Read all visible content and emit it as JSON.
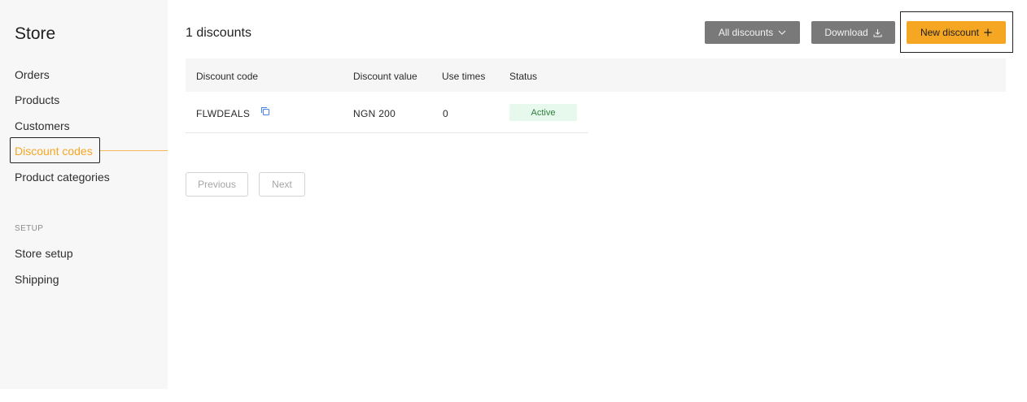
{
  "sidebar": {
    "title": "Store",
    "items": [
      {
        "label": "Orders"
      },
      {
        "label": "Products"
      },
      {
        "label": "Customers"
      },
      {
        "label": "Discount codes",
        "active": true
      },
      {
        "label": "Product categories"
      }
    ],
    "setup_label": "SETUP",
    "setup_items": [
      {
        "label": "Store setup"
      },
      {
        "label": "Shipping"
      }
    ]
  },
  "header": {
    "count_title": "1 discounts",
    "filter_label": "All discounts",
    "filter_icon": "chevron-down-icon",
    "download_label": "Download",
    "download_icon": "download-icon",
    "new_label": "New discount",
    "new_icon": "plus-icon"
  },
  "table": {
    "columns": [
      "Discount code",
      "Discount value",
      "Use times",
      "Status"
    ],
    "rows": [
      {
        "code": "FLWDEALS",
        "value": "NGN 200",
        "use_times": "0",
        "status": "Active"
      }
    ]
  },
  "pagination": {
    "previous_label": "Previous",
    "next_label": "Next"
  },
  "colors": {
    "accent": "#f5a623",
    "button_gray": "#797979",
    "active_badge_bg": "#e6f9ec",
    "active_badge_text": "#2e7d3e",
    "sidebar_bg": "#f7f7f7"
  }
}
